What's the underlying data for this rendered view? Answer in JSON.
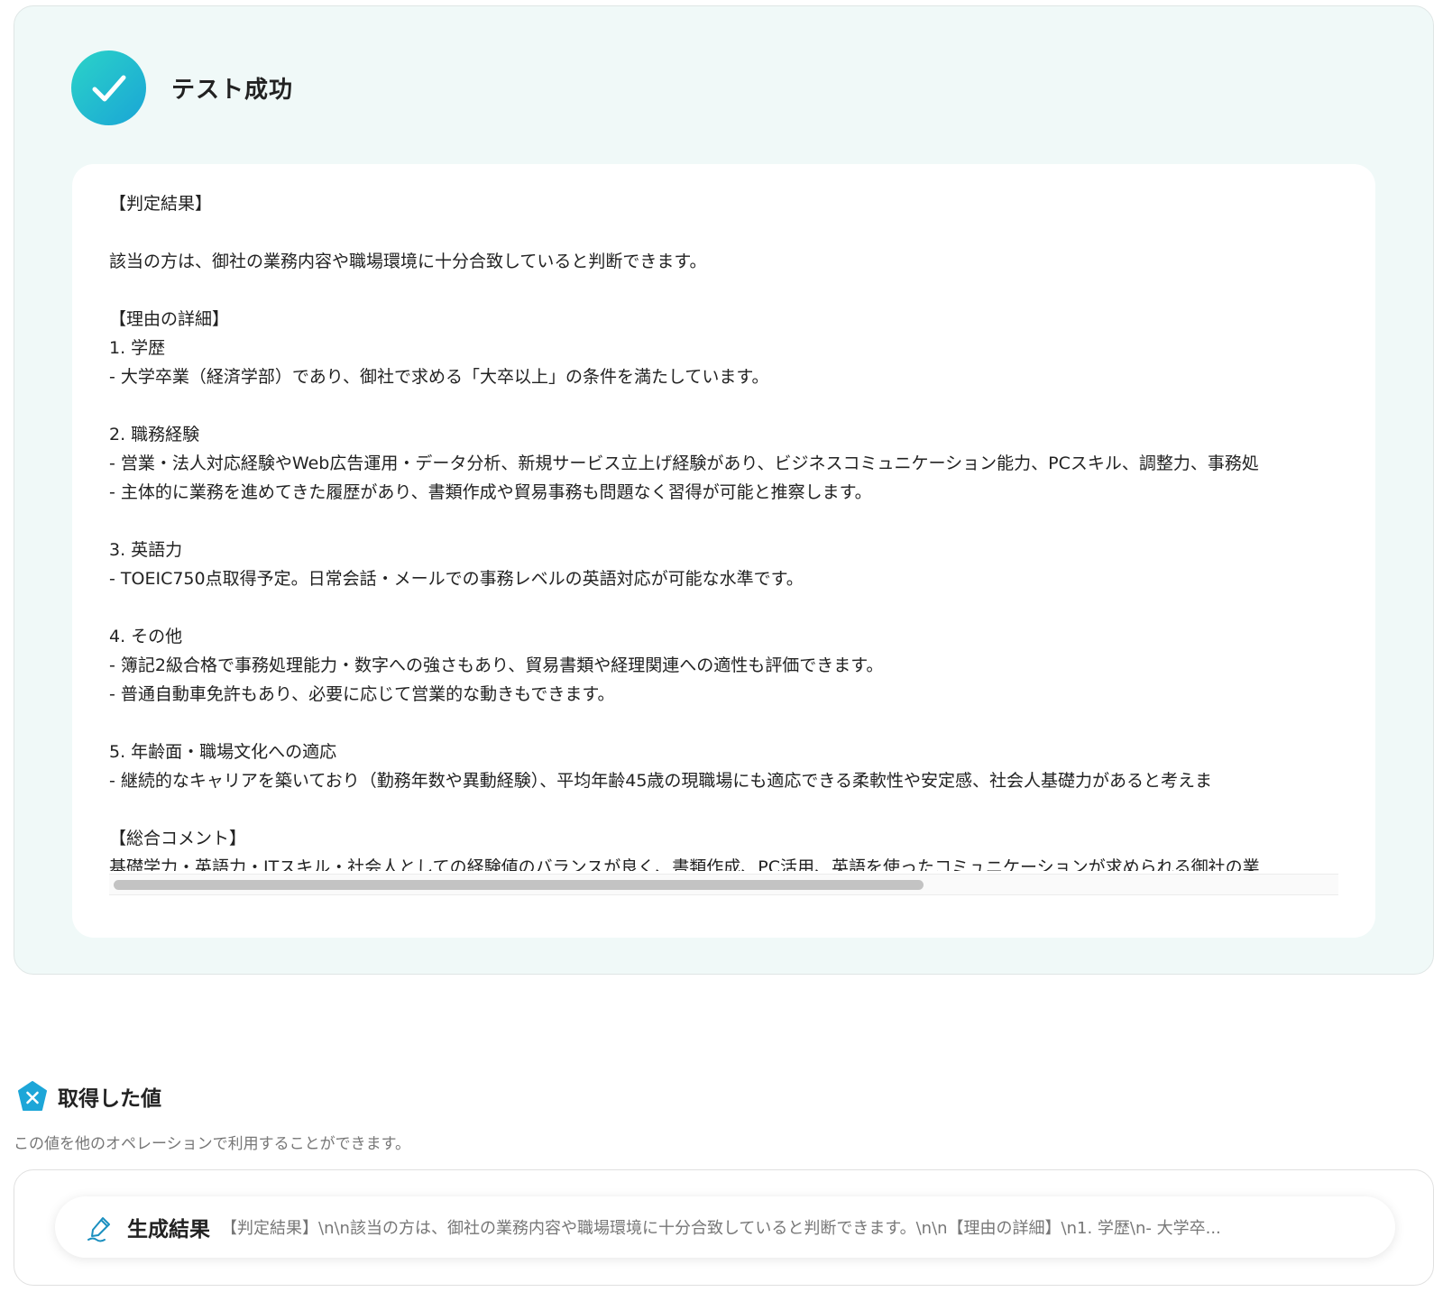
{
  "test_result": {
    "title": "テスト成功",
    "lines": [
      "【判定結果】",
      "",
      "該当の方は、御社の業務内容や職場環境に十分合致していると判断できます。",
      "",
      "【理由の詳細】",
      "1. 学歴",
      "- 大学卒業（経済学部）であり、御社で求める「大卒以上」の条件を満たしています。",
      "",
      "2. 職務経験",
      "- 営業・法人対応経験やWeb広告運用・データ分析、新規サービス立上げ経験があり、ビジネスコミュニケーション能力、PCスキル、調整力、事務処",
      "- 主体的に業務を進めてきた履歴があり、書類作成や貿易事務も問題なく習得が可能と推察します。",
      "",
      "3. 英語力",
      "- TOEIC750点取得予定。日常会話・メールでの事務レベルの英語対応が可能な水準です。",
      "",
      "4. その他",
      "- 簿記2級合格で事務処理能力・数字への強さもあり、貿易書類や経理関連への適性も評価できます。",
      "- 普通自動車免許もあり、必要に応じて営業的な動きもできます。",
      "",
      "5. 年齢面・職場文化への適応",
      "- 継続的なキャリアを築いており（勤務年数や異動経験）、平均年齢45歳の現職場にも適応できる柔軟性や安定感、社会人基礎力があると考えま",
      "",
      "【総合コメント】",
      "基礎学力・英語力・ITスキル・社会人としての経験値のバランスが良く、書類作成、PC活用、英語を使ったコミュニケーションが求められる御社の業"
    ]
  },
  "obtained_values": {
    "title": "取得した値",
    "description": "この値を他のオペレーションで利用することができます。",
    "items": [
      {
        "label": "生成結果",
        "value": "【判定結果】\\n\\n該当の方は、御社の業務内容や職場環境に十分合致していると判断できます。\\n\\n【理由の詳細】\\n1. 学歴\\n- 大学卒..."
      }
    ]
  },
  "icons": {
    "success": "check-icon",
    "values": "variable-icon",
    "item": "pen-icon"
  },
  "colors": {
    "accent_teal": "#2bd3c8",
    "accent_blue": "#1aa5d6",
    "panel_bg": "#f0f9f8"
  }
}
